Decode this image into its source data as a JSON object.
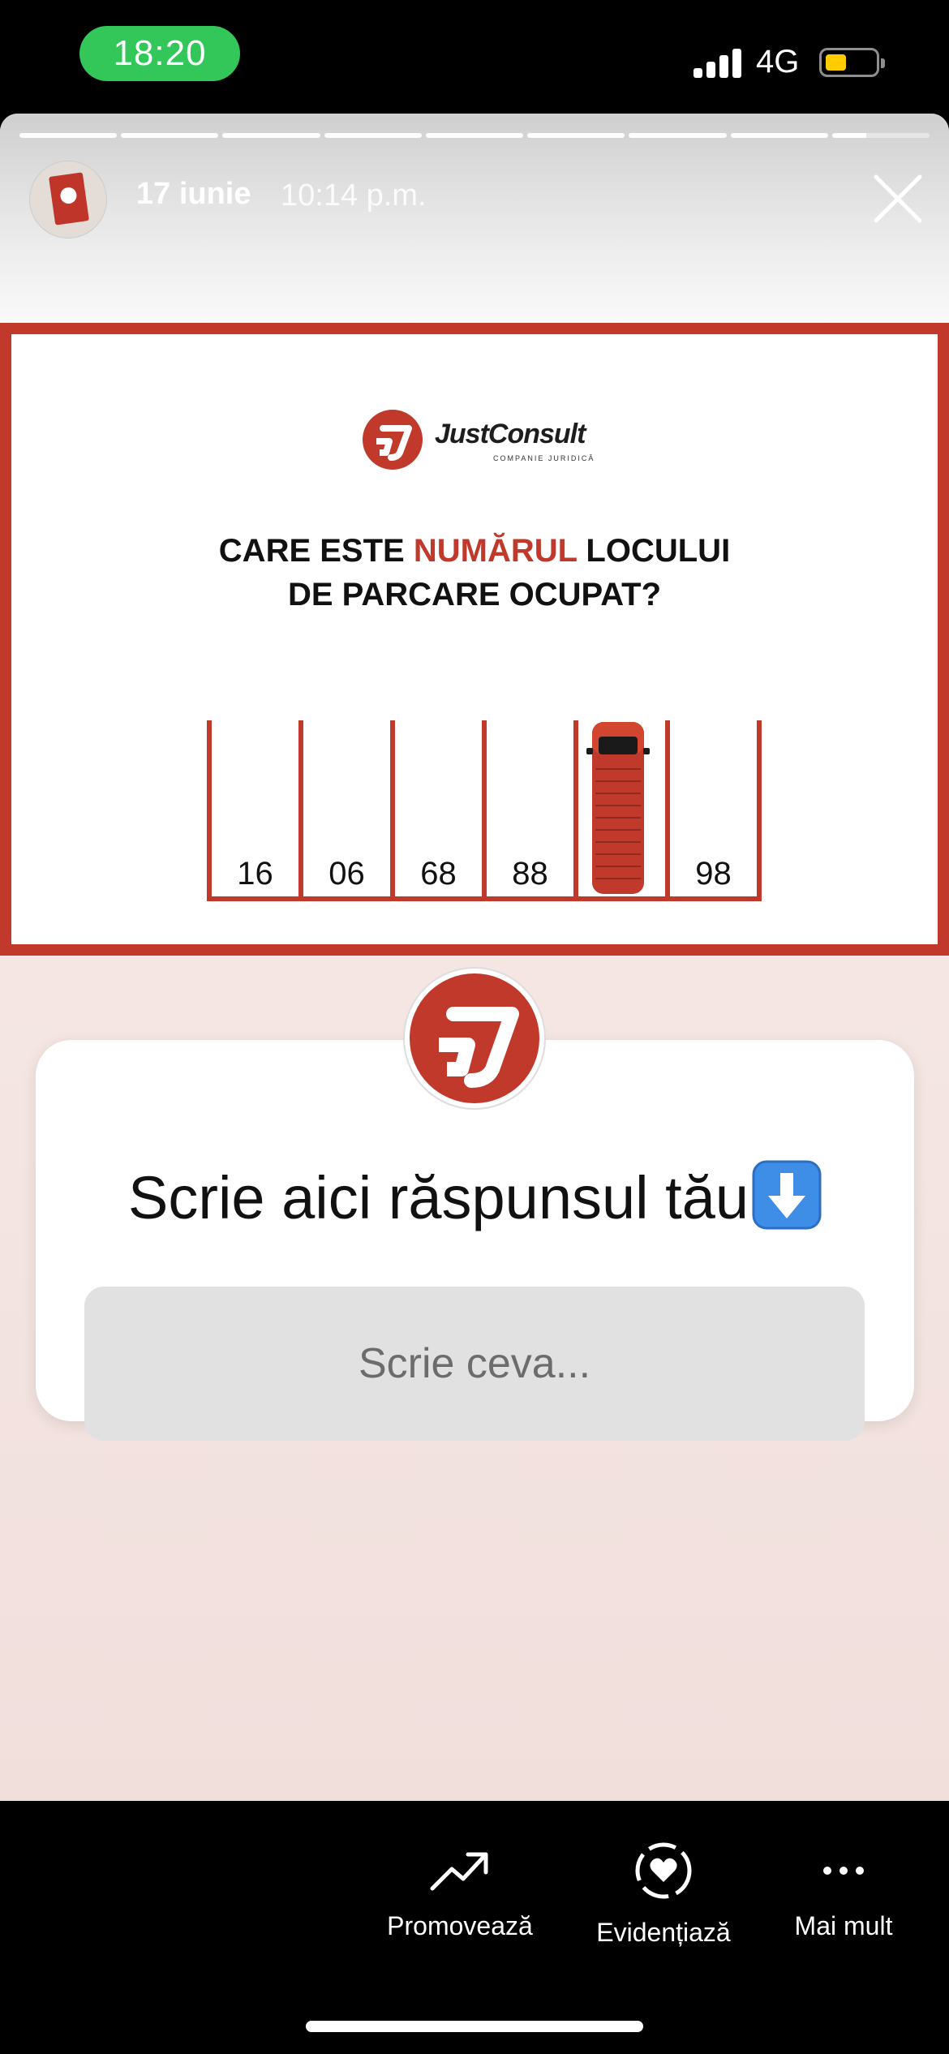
{
  "status_bar": {
    "time": "18:20",
    "network": "4G",
    "battery_level": 0.4,
    "battery_color": "#ffcc00",
    "time_pill_color": "#33c759"
  },
  "story": {
    "segments_total": 9,
    "segments_viewed": 8,
    "current_segment_progress": 0.35,
    "date": "17 iunie",
    "time": "10:14 p.m.",
    "close_icon": "close-icon"
  },
  "post": {
    "brand_name": "JustConsult",
    "brand_subtitle": "COMPANIE JURIDICĂ",
    "question_part1": "CARE ESTE ",
    "question_highlight": "NUMĂRUL",
    "question_part2": " LOCULUI",
    "question_line2": "DE PARCARE OCUPAT?",
    "parking_numbers": [
      "16",
      "06",
      "68",
      "88",
      "",
      "98"
    ],
    "accent_color": "#c0392b"
  },
  "reply_sticker": {
    "prompt": "Scrie aici răspunsul tău",
    "prompt_emoji": "down-arrow-icon",
    "placeholder": "Scrie ceva..."
  },
  "actions": {
    "promote": "Promovează",
    "highlight": "Evidențiază",
    "more": "Mai mult"
  }
}
